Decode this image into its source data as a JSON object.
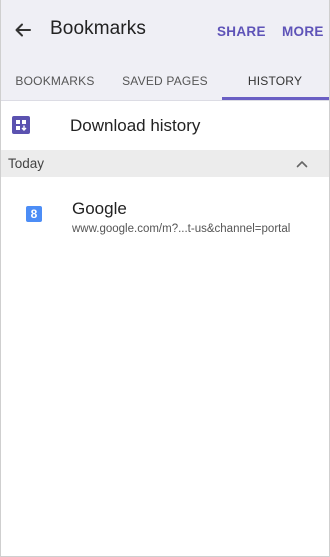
{
  "appbar": {
    "back_icon": "arrow-left-icon",
    "title": "Bookmarks",
    "actions": {
      "share": "SHARE",
      "more": "MORE"
    }
  },
  "tabs": [
    {
      "label": "BOOKMARKS",
      "selected": false
    },
    {
      "label": "SAVED PAGES",
      "selected": false
    },
    {
      "label": "HISTORY",
      "selected": true
    }
  ],
  "download_history": {
    "icon": "download-history-icon",
    "label": "Download history"
  },
  "section": {
    "title": "Today",
    "collapse_icon": "chevron-up-icon"
  },
  "history_items": [
    {
      "icon": "google-favicon-icon",
      "icon_glyph": "8",
      "title": "Google",
      "url": "www.google.com/m?...t-us&channel=portal"
    }
  ],
  "colors": {
    "accent": "#5e53b8",
    "appbar_background": "#efeff5",
    "section_background": "#ececec",
    "favicon": "#4c8df6"
  }
}
